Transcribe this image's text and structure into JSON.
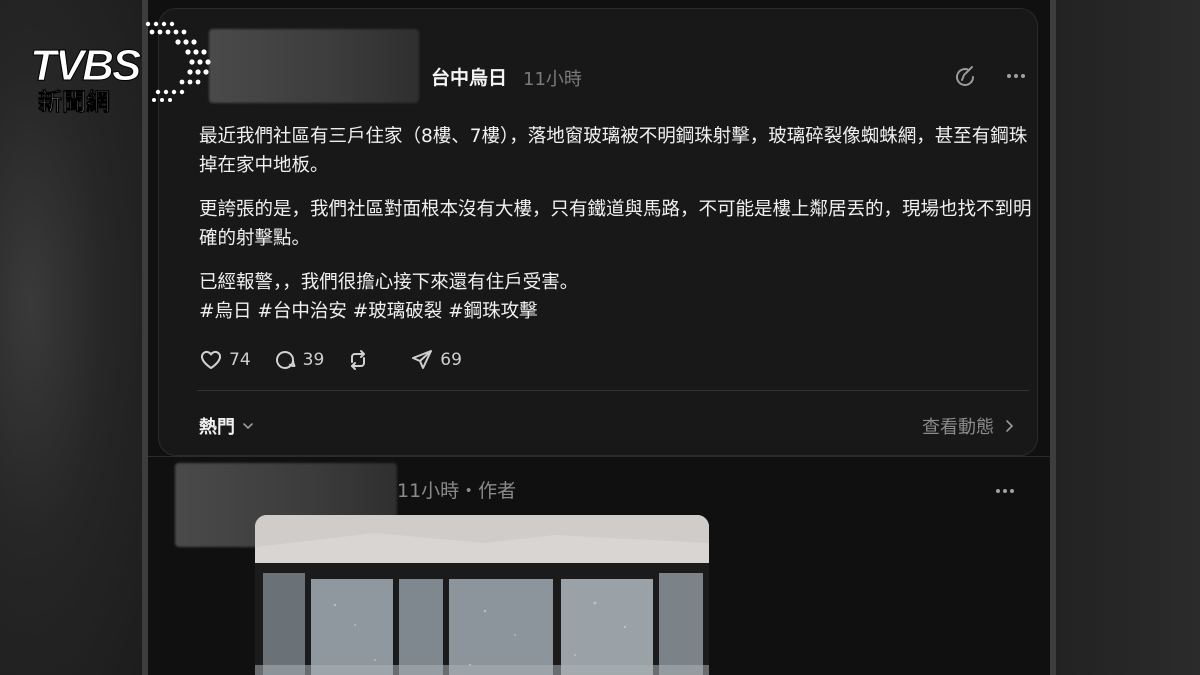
{
  "watermark": {
    "brand": "TVBS",
    "subtitle": "新聞網"
  },
  "post": {
    "author": "台中烏日",
    "time": "11小時",
    "paragraphs": [
      "最近我們社區有三戶住家（8樓、7樓），落地窗玻璃被不明鋼珠射擊，玻璃碎裂像蜘蛛網，甚至有鋼珠掉在家中地板。",
      "更誇張的是，我們社區對面根本沒有大樓，只有鐵道與馬路，不可能是樓上鄰居丟的，現場也找不到明確的射擊點。",
      "已經報警，，我們很擔心接下來還有住戶受害。"
    ],
    "hashtags": "#烏日 #台中治安 #玻璃破裂 #鋼珠攻擊",
    "likes": "74",
    "comments": "39",
    "shares": "69"
  },
  "replies_header": {
    "sort_label": "熱門",
    "activity_label": "查看動態"
  },
  "reply": {
    "meta": "11小時・作者"
  },
  "icons": {
    "edit": "edit-circle-icon",
    "more": "more-dots-icon",
    "like": "heart-icon",
    "comment": "comment-icon",
    "repost": "repost-icon",
    "share": "send-icon",
    "sort": "chevron-down-icon",
    "activity": "chevron-right-icon"
  },
  "colors": {
    "background": "#101010",
    "card": "#181818",
    "text": "#f3f3f3",
    "muted": "#7a7a7a",
    "watermark": "#ffffff"
  }
}
